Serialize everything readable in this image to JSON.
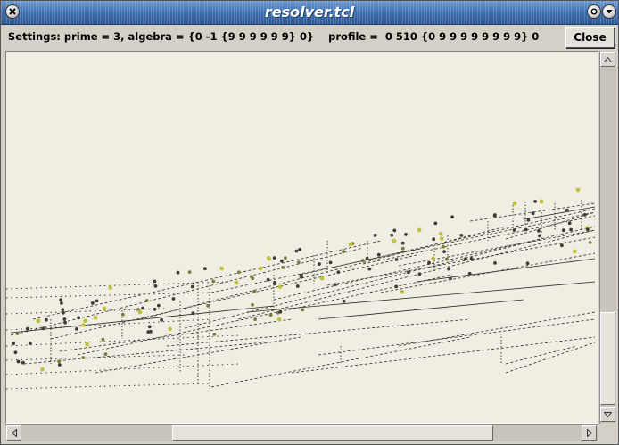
{
  "window": {
    "title": "resolver.tcl"
  },
  "toolbar": {
    "settings_text": "Settings: prime = 3, algebra = {0 -1 {9 9 9 9 9 9} 0}    profile =  0 510 {0 9 9 9 9 9 9 9 9} 0",
    "close_label": "Close"
  },
  "icons": {
    "window_close": "close-x-icon",
    "window_shade": "shade-icon",
    "window_menu": "menu-arrow-icon",
    "scroll_up": "arrow-up-icon",
    "scroll_down": "arrow-down-icon",
    "scroll_left": "arrow-left-icon",
    "scroll_right": "arrow-right-icon"
  },
  "colors": {
    "titlebar": "#3b6db0",
    "canvas_bg": "#f1ede2",
    "dot_dark": "#3c3c34",
    "dot_olive": "#7a7a3a",
    "dot_yellow": "#bcc23c"
  }
}
